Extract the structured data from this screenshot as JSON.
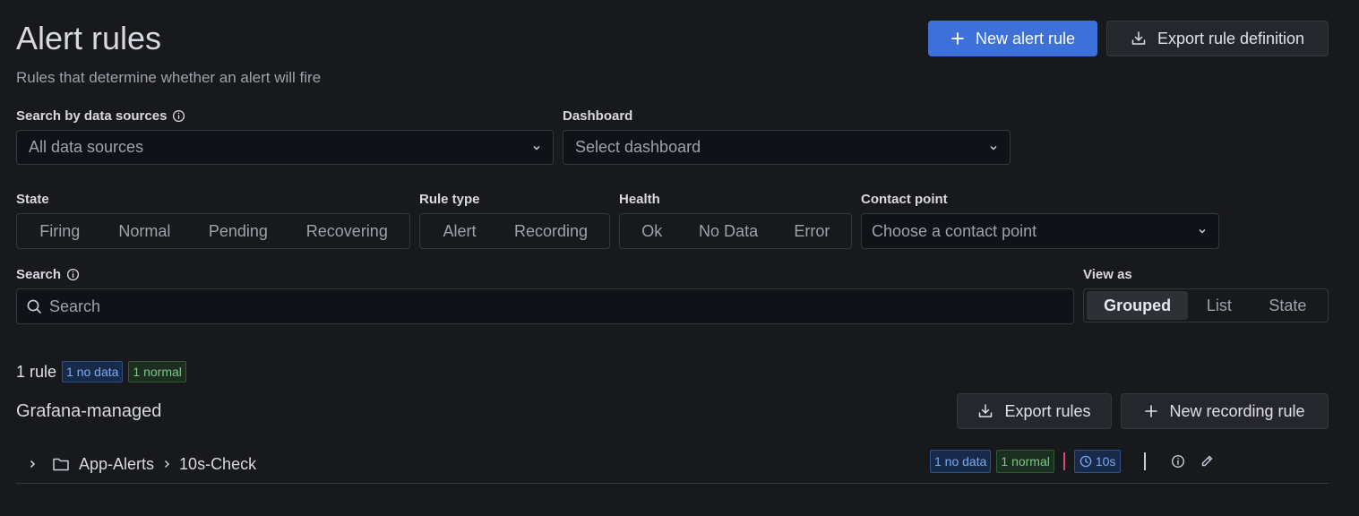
{
  "header": {
    "title": "Alert rules",
    "subtitle": "Rules that determine whether an alert will fire",
    "new_alert_rule": "New alert rule",
    "export_rule_definition": "Export rule definition"
  },
  "filters": {
    "datasource_label": "Search by data sources",
    "datasource_value": "All data sources",
    "dashboard_label": "Dashboard",
    "dashboard_value": "Select dashboard",
    "state_label": "State",
    "state_options": [
      "Firing",
      "Normal",
      "Pending",
      "Recovering"
    ],
    "rule_type_label": "Rule type",
    "rule_type_options": [
      "Alert",
      "Recording"
    ],
    "health_label": "Health",
    "health_options": [
      "Ok",
      "No Data",
      "Error"
    ],
    "contact_point_label": "Contact point",
    "contact_point_value": "Choose a contact point",
    "search_label": "Search",
    "search_placeholder": "Search",
    "view_as_label": "View as",
    "view_as_options": [
      "Grouped",
      "List",
      "State"
    ],
    "view_as_selected": "Grouped"
  },
  "summary": {
    "count": "1 rule",
    "no_data_badge": "1 no data",
    "normal_badge": "1 normal"
  },
  "section": {
    "title": "Grafana-managed",
    "export_rules": "Export rules",
    "new_recording_rule": "New recording rule"
  },
  "group_row": {
    "folder": "App-Alerts",
    "group": "10s-Check",
    "no_data_badge": "1 no data",
    "normal_badge": "1 normal",
    "interval": "10s"
  },
  "colors": {
    "background": "#18191d",
    "primary": "#3d71d9",
    "badge_blue": "#7fa8f0",
    "badge_green": "#82c48b"
  }
}
